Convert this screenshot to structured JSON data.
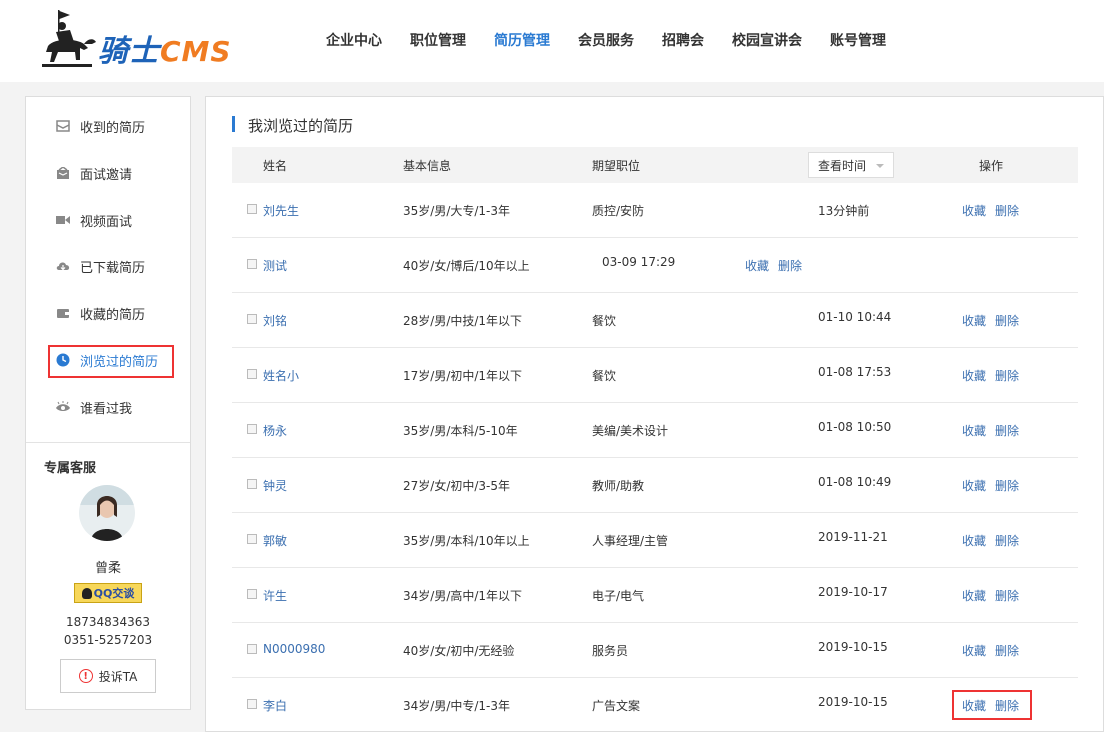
{
  "header": {
    "logo_main": "骑士",
    "logo_accent": "CMS",
    "nav": [
      {
        "label": "企业中心",
        "active": false
      },
      {
        "label": "职位管理",
        "active": false
      },
      {
        "label": "简历管理",
        "active": true
      },
      {
        "label": "会员服务",
        "active": false
      },
      {
        "label": "招聘会",
        "active": false
      },
      {
        "label": "校园宣讲会",
        "active": false
      },
      {
        "label": "账号管理",
        "active": false
      }
    ]
  },
  "sidebar": {
    "items": [
      {
        "label": "收到的简历",
        "icon": "inbox-icon"
      },
      {
        "label": "面试邀请",
        "icon": "envelope-icon"
      },
      {
        "label": "视频面试",
        "icon": "video-icon"
      },
      {
        "label": "已下载简历",
        "icon": "cloud-download-icon"
      },
      {
        "label": "收藏的简历",
        "icon": "wallet-icon"
      },
      {
        "label": "浏览过的简历",
        "icon": "clock-icon"
      },
      {
        "label": "谁看过我",
        "icon": "eye-icon"
      }
    ],
    "service": {
      "title": "专属客服",
      "name": "曾柔",
      "qq_label": "QQ交谈",
      "mobile": "18734834363",
      "phone": "0351-5257203",
      "complain_label": "投诉TA"
    }
  },
  "main": {
    "title": "我浏览过的简历",
    "columns": {
      "name": "姓名",
      "info": "基本信息",
      "position": "期望职位",
      "sort": "查看时间",
      "ops": "操作"
    },
    "ops": {
      "favorite": "收藏",
      "delete": "删除"
    },
    "rows": [
      {
        "name": "刘先生",
        "info": "35岁/男/大专/1-3年",
        "position": "质控/安防",
        "time": "13分钟前"
      },
      {
        "name": "测试",
        "info": "40岁/女/博后/10年以上",
        "position": "",
        "time": "03-09 17:29"
      },
      {
        "name": "刘铭",
        "info": "28岁/男/中技/1年以下",
        "position": "餐饮",
        "time": "01-10 10:44"
      },
      {
        "name": "姓名小",
        "info": "17岁/男/初中/1年以下",
        "position": "餐饮",
        "time": "01-08 17:53"
      },
      {
        "name": "杨永",
        "info": "35岁/男/本科/5-10年",
        "position": "美编/美术设计",
        "time": "01-08 10:50"
      },
      {
        "name": "钟灵",
        "info": "27岁/女/初中/3-5年",
        "position": "教师/助教",
        "time": "01-08 10:49"
      },
      {
        "name": "郭敏",
        "info": "35岁/男/本科/10年以上",
        "position": "人事经理/主管",
        "time": "2019-11-21"
      },
      {
        "name": "许生",
        "info": "34岁/男/高中/1年以下",
        "position": "电子/电气",
        "time": "2019-10-17"
      },
      {
        "name": "N0000980",
        "info": "40岁/女/初中/无经验",
        "position": "服务员",
        "time": "2019-10-15"
      },
      {
        "name": "李白",
        "info": "34岁/男/中专/1-3年",
        "position": "广告文案",
        "time": "2019-10-15"
      }
    ]
  }
}
